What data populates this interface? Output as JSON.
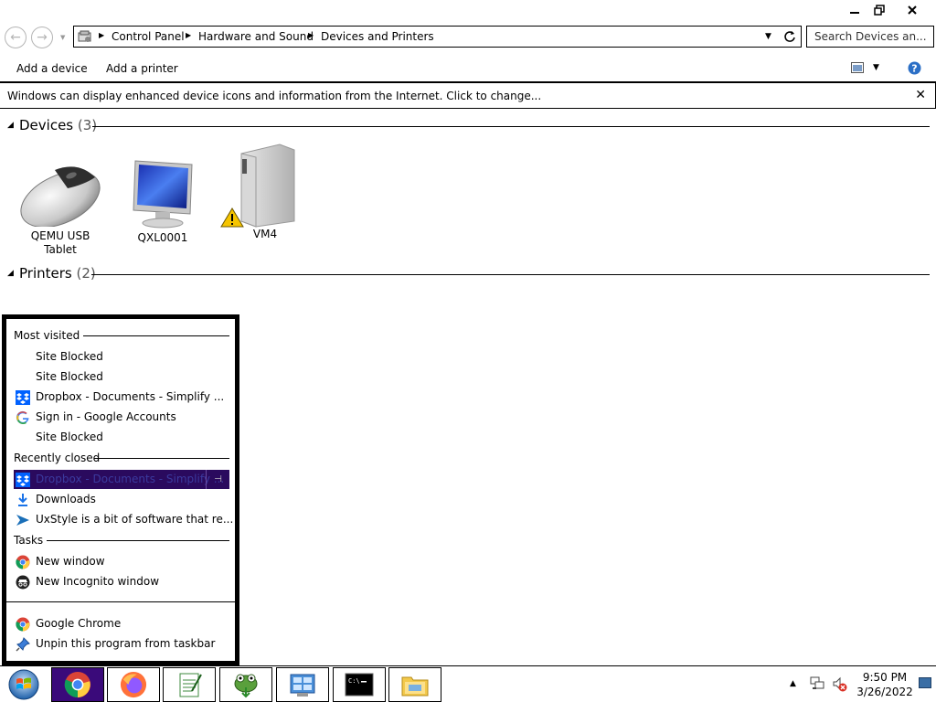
{
  "window": {
    "buttons": {
      "minimize": "minimize",
      "restore": "restore",
      "close": "close"
    }
  },
  "nav": {
    "breadcrumbs": [
      "Control Panel",
      "Hardware and Sound",
      "Devices and Printers"
    ],
    "search_placeholder": "Search Devices an..."
  },
  "toolbar": {
    "add_device": "Add a device",
    "add_printer": "Add a printer"
  },
  "infobar": {
    "message": "Windows can display enhanced device icons and information from the Internet. Click to change...",
    "close": "✕"
  },
  "groups": {
    "devices": {
      "title": "Devices",
      "count": "(3)"
    },
    "printers": {
      "title": "Printers",
      "count": "(2)"
    }
  },
  "devices": [
    {
      "name_line1": "QEMU USB",
      "name_line2": "Tablet",
      "icon": "mouse-icon"
    },
    {
      "name_line1": "QXL0001",
      "name_line2": "",
      "icon": "monitor-icon"
    },
    {
      "name_line1": "VM4",
      "name_line2": "",
      "icon": "computer-tower-icon",
      "warning": true
    }
  ],
  "jumplist": {
    "most_visited_label": "Most visited",
    "most_visited": [
      {
        "text": "Site Blocked",
        "icon": "none"
      },
      {
        "text": "Site Blocked",
        "icon": "none"
      },
      {
        "text": "Dropbox - Documents - Simplify ...",
        "icon": "dropbox-icon"
      },
      {
        "text": "Sign in - Google Accounts",
        "icon": "google-icon"
      },
      {
        "text": "Site Blocked",
        "icon": "none"
      }
    ],
    "recently_closed_label": "Recently closed",
    "recently_closed": [
      {
        "text": "Dropbox - Documents - Simplify ...",
        "icon": "dropbox-icon",
        "highlighted": true
      },
      {
        "text": "Downloads",
        "icon": "download-icon"
      },
      {
        "text": "UxStyle is a bit of software that re...",
        "icon": "uxstyle-icon"
      }
    ],
    "tasks_label": "Tasks",
    "tasks": [
      {
        "text": "New window",
        "icon": "chrome-icon"
      },
      {
        "text": "New Incognito window",
        "icon": "incognito-icon"
      }
    ],
    "app": [
      {
        "text": "Google Chrome",
        "icon": "chrome-icon"
      },
      {
        "text": "Unpin this program from taskbar",
        "icon": "unpin-icon"
      }
    ]
  },
  "taskbar": {
    "time": "9:50 PM",
    "date": "3/26/2022",
    "apps": [
      "start-orb",
      "chrome",
      "firefox",
      "notepad",
      "utility",
      "control-panel",
      "command-prompt",
      "file-explorer"
    ]
  },
  "colors": {
    "chrome_active": "#3a0a7a",
    "highlight": "#2a0a5e",
    "dropbox": "#0061ff"
  }
}
